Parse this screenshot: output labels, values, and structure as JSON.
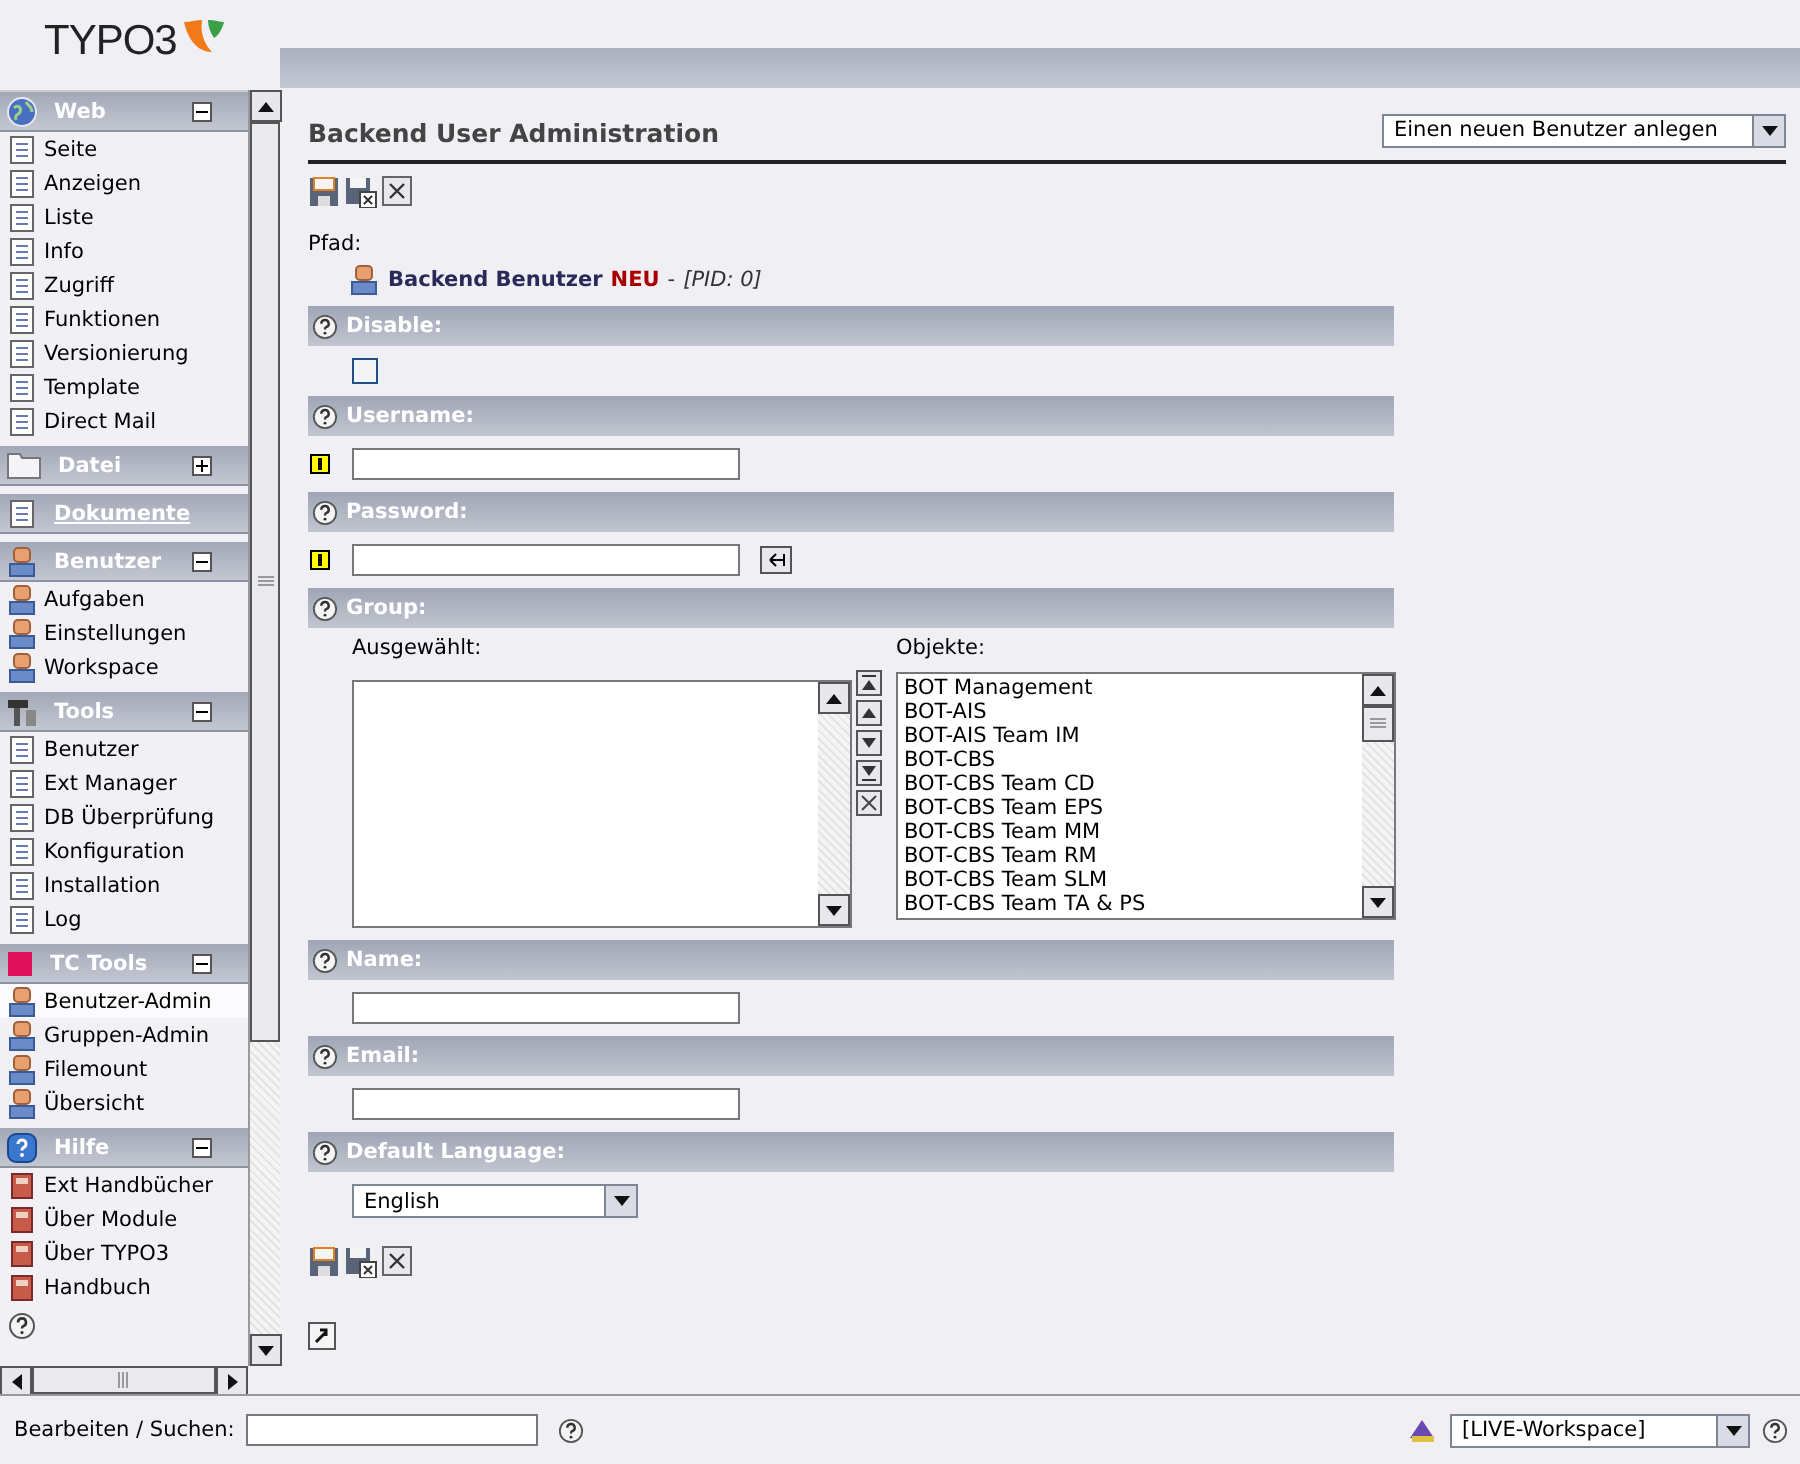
{
  "logo": {
    "text": "TYPO3"
  },
  "sidebar": {
    "groups": [
      {
        "title": "Web",
        "kind": "group",
        "expanded": true,
        "items": [
          {
            "label": "Seite",
            "selected": false
          },
          {
            "label": "Anzeigen",
            "selected": false
          },
          {
            "label": "Liste",
            "selected": false
          },
          {
            "label": "Info",
            "selected": false
          },
          {
            "label": "Zugriff",
            "selected": false
          },
          {
            "label": "Funktionen",
            "selected": false
          },
          {
            "label": "Versionierung",
            "selected": false
          },
          {
            "label": "Template",
            "selected": false
          },
          {
            "label": "Direct Mail",
            "selected": false
          }
        ]
      },
      {
        "title": "Datei",
        "kind": "group",
        "expanded": false
      },
      {
        "title": "Dokumente",
        "kind": "link"
      },
      {
        "title": "Benutzer",
        "kind": "group",
        "expanded": true,
        "items": [
          {
            "label": "Aufgaben",
            "selected": false
          },
          {
            "label": "Einstellungen",
            "selected": false
          },
          {
            "label": "Workspace",
            "selected": false
          }
        ]
      },
      {
        "title": "Tools",
        "kind": "group",
        "expanded": true,
        "items": [
          {
            "label": "Benutzer",
            "selected": false
          },
          {
            "label": "Ext Manager",
            "selected": false
          },
          {
            "label": "DB Überprüfung",
            "selected": false
          },
          {
            "label": "Konfiguration",
            "selected": false
          },
          {
            "label": "Installation",
            "selected": false
          },
          {
            "label": "Log",
            "selected": false
          }
        ]
      },
      {
        "title": "TC Tools",
        "kind": "group",
        "expanded": true,
        "items": [
          {
            "label": "Benutzer-Admin",
            "selected": true
          },
          {
            "label": "Gruppen-Admin",
            "selected": false
          },
          {
            "label": "Filemount",
            "selected": false
          },
          {
            "label": "Übersicht",
            "selected": false
          }
        ]
      },
      {
        "title": "Hilfe",
        "kind": "group",
        "expanded": true,
        "items": [
          {
            "label": "Ext Handbücher",
            "selected": false
          },
          {
            "label": "Über Module",
            "selected": false
          },
          {
            "label": "Über TYPO3",
            "selected": false
          },
          {
            "label": "Handbuch",
            "selected": false
          }
        ]
      }
    ]
  },
  "header": {
    "title": "Backend User Administration",
    "action_select": "Einen neuen Benutzer anlegen"
  },
  "path": {
    "label": "Pfad:",
    "record_type": "Backend Benutzer",
    "status": "NEU",
    "separator": "-",
    "pid": "[PID: 0]"
  },
  "fields": [
    {
      "kind": "checkbox",
      "label": "Disable:",
      "checked": false
    },
    {
      "kind": "text",
      "label": "Username:",
      "required": true
    },
    {
      "kind": "password",
      "label": "Password:",
      "required": true
    },
    {
      "kind": "group",
      "label": "Group:",
      "selected_label": "Ausgewählt:",
      "available_label": "Objekte:",
      "options": [
        "BOT Management",
        "BOT-AIS",
        "BOT-AIS Team IM",
        "BOT-CBS",
        "BOT-CBS Team CD",
        "BOT-CBS Team EPS",
        "BOT-CBS Team MM",
        "BOT-CBS Team RM",
        "BOT-CBS Team SLM",
        "BOT-CBS Team TA & PS"
      ]
    },
    {
      "kind": "text",
      "label": "Name:",
      "required": false
    },
    {
      "kind": "text",
      "label": "Email:",
      "required": false
    },
    {
      "kind": "select",
      "label": "Default Language:",
      "value": "English"
    }
  ],
  "footer": {
    "search_label": "Bearbeiten / Suchen:",
    "workspace": "[LIVE-Workspace]"
  }
}
